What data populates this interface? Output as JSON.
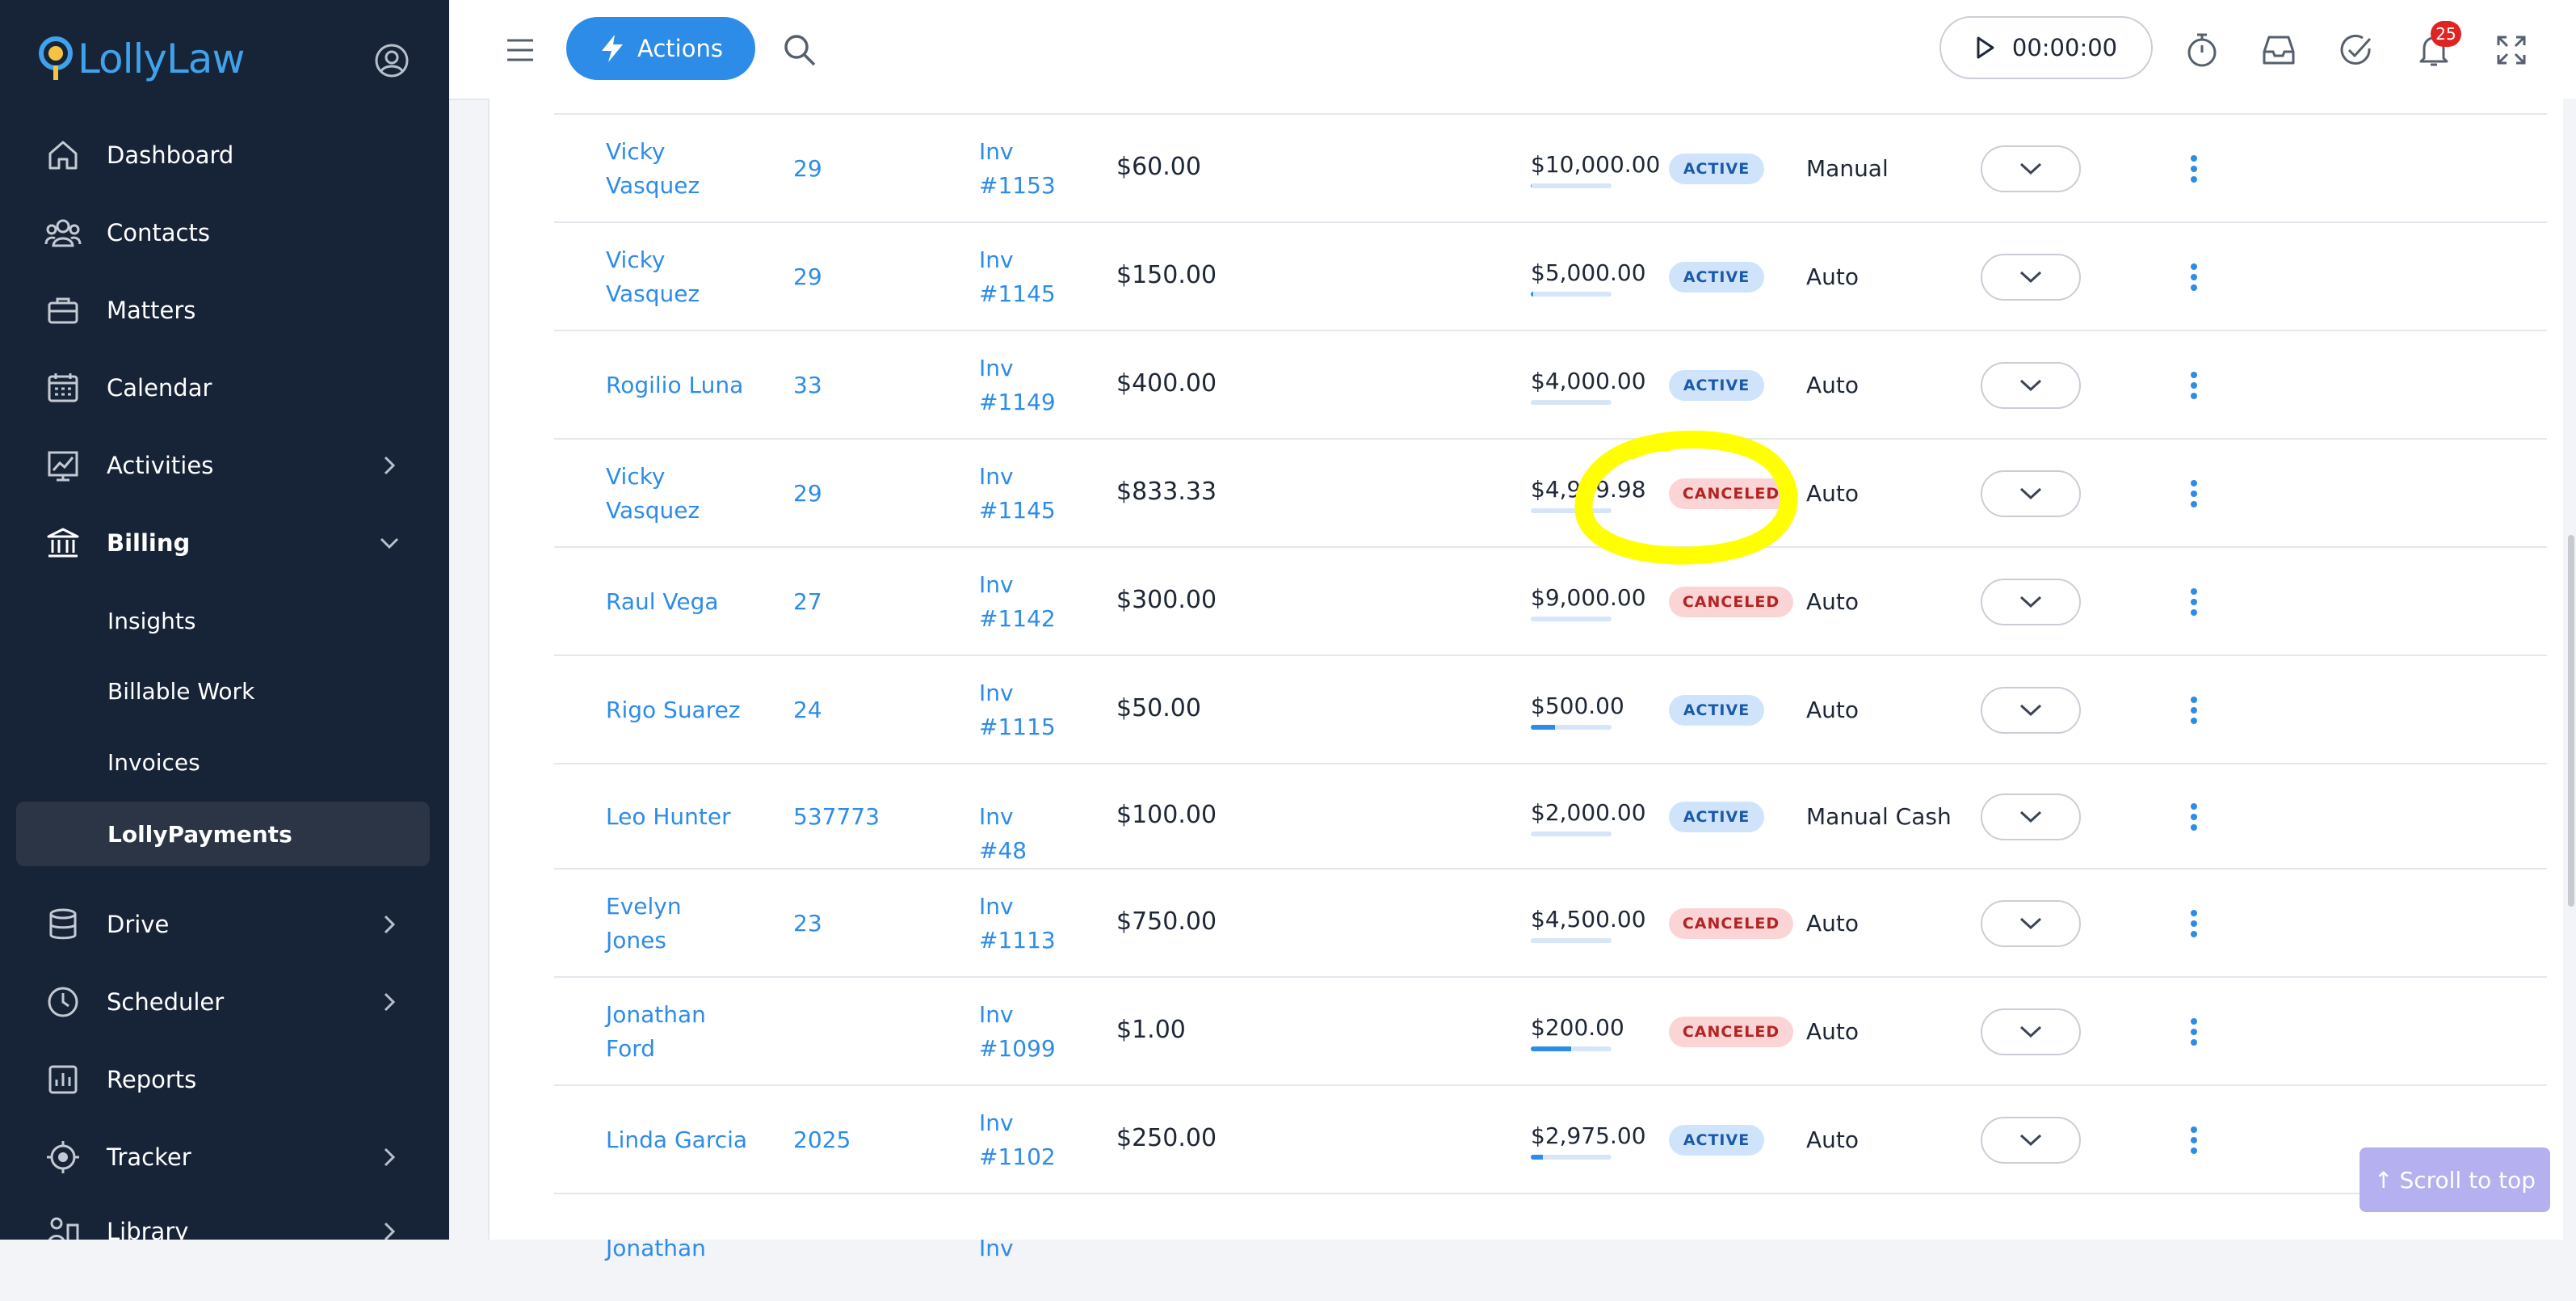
{
  "sidebar": {
    "logo_text": "LollyLaw",
    "nav": [
      {
        "label": "Dashboard",
        "icon": "home-icon"
      },
      {
        "label": "Contacts",
        "icon": "contacts-icon"
      },
      {
        "label": "Matters",
        "icon": "briefcase-icon"
      },
      {
        "label": "Calendar",
        "icon": "calendar-icon"
      },
      {
        "label": "Activities",
        "icon": "chart-icon"
      },
      {
        "label": "Billing",
        "icon": "bank-icon"
      },
      {
        "label": "Drive",
        "icon": "database-icon"
      },
      {
        "label": "Scheduler",
        "icon": "clock-icon"
      },
      {
        "label": "Reports",
        "icon": "reports-icon"
      },
      {
        "label": "Tracker",
        "icon": "target-icon"
      },
      {
        "label": "Library",
        "icon": "library-icon"
      }
    ],
    "billing_sub": [
      "Insights",
      "Billable Work",
      "Invoices",
      "LollyPayments"
    ]
  },
  "topbar": {
    "actions_label": "Actions",
    "timer": "00:00:00",
    "notification_count": "25"
  },
  "colors": {
    "sidebar_bg": "#172336",
    "accent": "#2d8ce8",
    "active_badge": "#cfe4fb",
    "canceled_badge": "#fbd5d5",
    "highlight": "#ffff00"
  },
  "rows": [
    {
      "name_line1": "Vicky",
      "name_line2": "Vasquez",
      "num": "29",
      "inv_line1": "Inv",
      "inv_line2": "#1153",
      "amount": "$60.00",
      "total": "$10,000.00",
      "progress": 0.006,
      "status": "ACTIVE",
      "mode": "Manual"
    },
    {
      "name_line1": "Vicky",
      "name_line2": "Vasquez",
      "num": "29",
      "inv_line1": "Inv",
      "inv_line2": "#1145",
      "amount": "$150.00",
      "total": "$5,000.00",
      "progress": 0.03,
      "status": "ACTIVE",
      "mode": "Auto"
    },
    {
      "name_line1": "Rogilio Luna",
      "name_line2": "",
      "num": "33",
      "inv_line1": "Inv",
      "inv_line2": "#1149",
      "amount": "$400.00",
      "total": "$4,000.00",
      "progress": 0.0,
      "status": "ACTIVE",
      "mode": "Auto"
    },
    {
      "name_line1": "Vicky",
      "name_line2": "Vasquez",
      "num": "29",
      "inv_line1": "Inv",
      "inv_line2": "#1145",
      "amount": "$833.33",
      "total": "$4,999.98",
      "progress": 0.0,
      "status": "CANCELED",
      "mode": "Auto"
    },
    {
      "name_line1": "Raul Vega",
      "name_line2": "",
      "num": "27",
      "inv_line1": "Inv",
      "inv_line2": "#1142",
      "amount": "$300.00",
      "total": "$9,000.00",
      "progress": 0.0,
      "status": "CANCELED",
      "mode": "Auto"
    },
    {
      "name_line1": "Rigo Suarez",
      "name_line2": "",
      "num": "24",
      "inv_line1": "Inv",
      "inv_line2": "#1115",
      "amount": "$50.00",
      "total": "$500.00",
      "progress": 0.3,
      "status": "ACTIVE",
      "mode": "Auto"
    },
    {
      "name_line1": "Leo Hunter",
      "name_line2": "",
      "num": "537773",
      "inv_line1": "Inv #48",
      "inv_line2": "",
      "amount": "$100.00",
      "total": "$2,000.00",
      "progress": 0.0,
      "status": "ACTIVE",
      "mode": "Manual Cash"
    },
    {
      "name_line1": "Evelyn",
      "name_line2": "Jones",
      "num": "23",
      "inv_line1": "Inv",
      "inv_line2": "#1113",
      "amount": "$750.00",
      "total": "$4,500.00",
      "progress": 0.0,
      "status": "CANCELED",
      "mode": "Auto"
    },
    {
      "name_line1": "Jonathan",
      "name_line2": "Ford",
      "num": "",
      "inv_line1": "Inv",
      "inv_line2": "#1099",
      "amount": "$1.00",
      "total": "$200.00",
      "progress": 0.5,
      "status": "CANCELED",
      "mode": "Auto"
    },
    {
      "name_line1": "Linda Garcia",
      "name_line2": "",
      "num": "2025",
      "inv_line1": "Inv",
      "inv_line2": "#1102",
      "amount": "$250.00",
      "total": "$2,975.00",
      "progress": 0.15,
      "status": "ACTIVE",
      "mode": "Auto"
    },
    {
      "name_line1": "Jonathan",
      "name_line2": "",
      "num": "",
      "inv_line1": "Inv",
      "inv_line2": "",
      "amount": "",
      "total": "",
      "progress": 0.0,
      "status": "",
      "mode": ""
    }
  ],
  "scroll_top_label": "Scroll to top"
}
